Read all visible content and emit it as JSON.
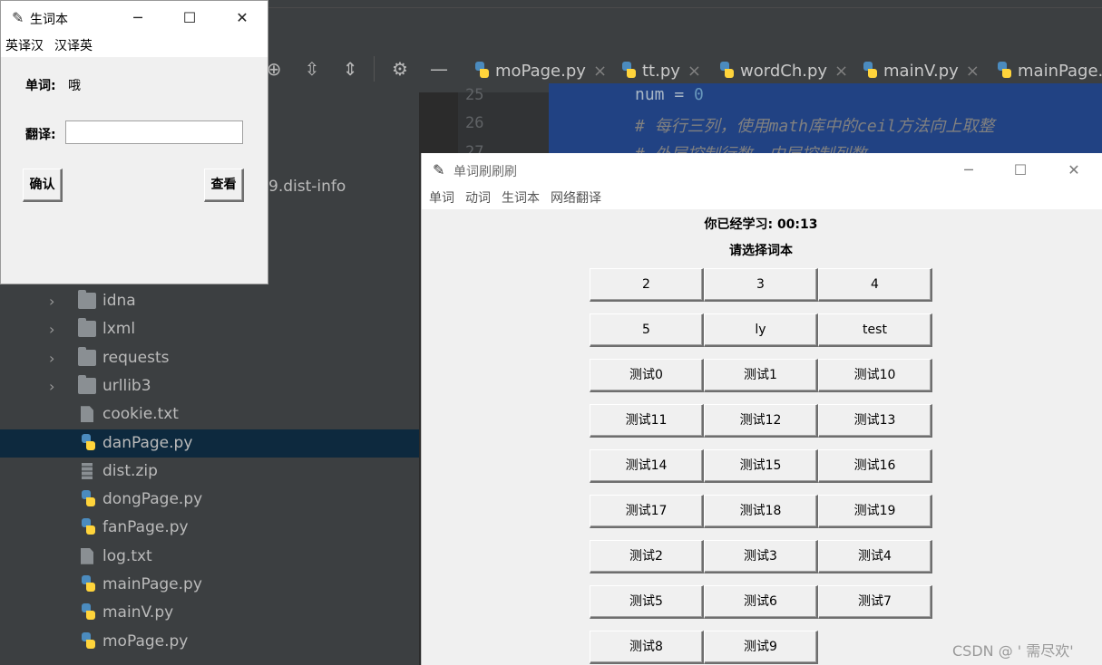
{
  "ide": {
    "tabs": [
      "moPage.py",
      "tt.py",
      "wordCh.py",
      "mainV.py",
      "mainPage.py"
    ],
    "line_numbers": [
      "25",
      "26",
      "27"
    ],
    "code_line1": "num = ",
    "code_line1_num": "0",
    "code_line2": "# 每行三列，使用math库中的ceil方法向上取整",
    "code_line3": "# 外层控制行数，内层控制列数",
    "dist_info_partial": "9.dist-info",
    "tree_folders": [
      "idna",
      "lxml",
      "requests",
      "urllib3"
    ],
    "tree_files": [
      {
        "name": "cookie.txt",
        "kind": "file"
      },
      {
        "name": "danPage.py",
        "kind": "py",
        "selected": true
      },
      {
        "name": "dist.zip",
        "kind": "zip"
      },
      {
        "name": "dongPage.py",
        "kind": "py"
      },
      {
        "name": "fanPage.py",
        "kind": "py"
      },
      {
        "name": "log.txt",
        "kind": "file"
      },
      {
        "name": "mainPage.py",
        "kind": "py"
      },
      {
        "name": "mainV.py",
        "kind": "py"
      },
      {
        "name": "moPage.py",
        "kind": "py"
      }
    ]
  },
  "vocab_window": {
    "title": "生词本",
    "menu": [
      "英译汉",
      "汉译英"
    ],
    "word_label": "单词:",
    "word_value": "哦",
    "translate_label": "翻译:",
    "translate_value": "",
    "confirm_button": "确认",
    "view_button": "查看"
  },
  "main_window": {
    "title": "单词刷刷刷",
    "menu": [
      "单词",
      "动词",
      "生词本",
      "网络翻译"
    ],
    "study_time": "你已经学习: 00:13",
    "prompt": "请选择词本",
    "books": [
      "2",
      "3",
      "4",
      "5",
      "ly",
      "test",
      "测试0",
      "测试1",
      "测试10",
      "测试11",
      "测试12",
      "测试13",
      "测试14",
      "测试15",
      "测试16",
      "测试17",
      "测试18",
      "测试19",
      "测试2",
      "测试3",
      "测试4",
      "测试5",
      "测试6",
      "测试7",
      "测试8",
      "测试9"
    ]
  },
  "watermark": "CSDN @ ' 需尽欢'",
  "icons": {
    "window_icon": "feather-icon",
    "minimize": "minimize-icon",
    "maximize": "maximize-icon",
    "close": "close-icon"
  }
}
